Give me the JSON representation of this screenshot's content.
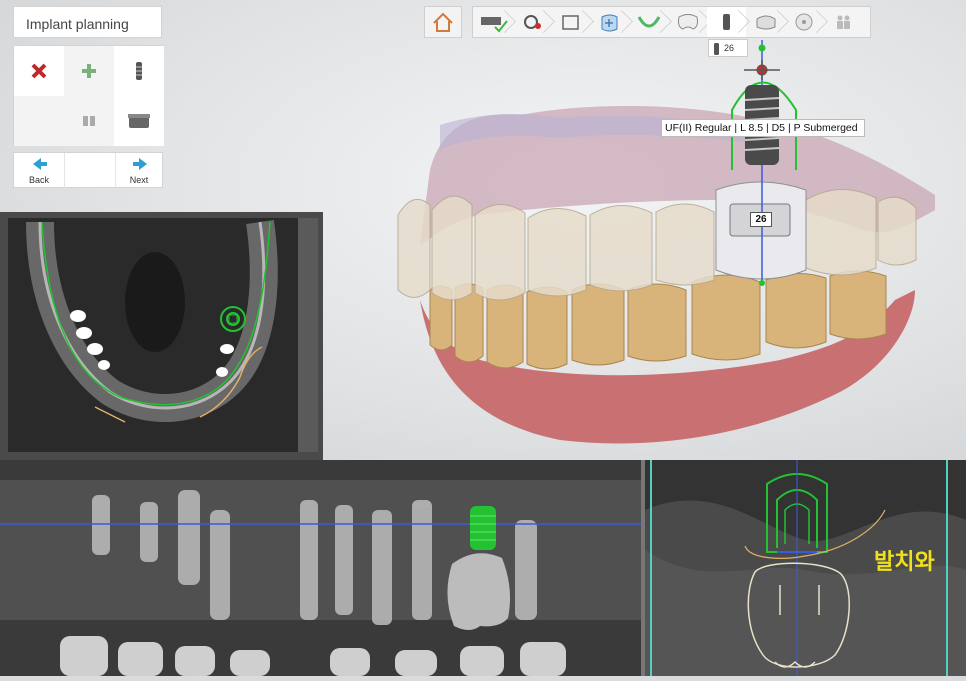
{
  "sidebar": {
    "title": "Implant planning",
    "tools": [
      {
        "name": "delete-implant",
        "icon": "red-x-icon"
      },
      {
        "name": "add-implant",
        "icon": "green-plus-icon"
      },
      {
        "name": "implant-library",
        "icon": "implant-screw-icon"
      },
      {
        "name": "empty",
        "icon": ""
      },
      {
        "name": "abutment",
        "icon": "abutment-icon"
      },
      {
        "name": "sleeve",
        "icon": "sleeve-icon"
      }
    ],
    "nav": {
      "back_label": "Back",
      "next_label": "Next"
    }
  },
  "toolbar": {
    "home_icon": "home-icon",
    "steps": [
      "scan-check-icon",
      "settings-icon",
      "panorama-icon",
      "add-tooth-icon",
      "arch-icon",
      "tooth-icon",
      "implant-icon",
      "crown-icon",
      "disc-icon",
      "people-icon"
    ]
  },
  "implant": {
    "chip_number": "26",
    "label": "UF(II) Regular | L 8.5 | D5 | P Submerged",
    "tooth_number": "26"
  },
  "annotation": {
    "text": "발치와"
  },
  "colors": {
    "implant_green": "#22c232",
    "axis_blue": "#3b5bdc",
    "highlight_red": "#d12a2a",
    "annotation_yellow": "#f1e01c",
    "nerve_orange": "#e0b06a"
  }
}
